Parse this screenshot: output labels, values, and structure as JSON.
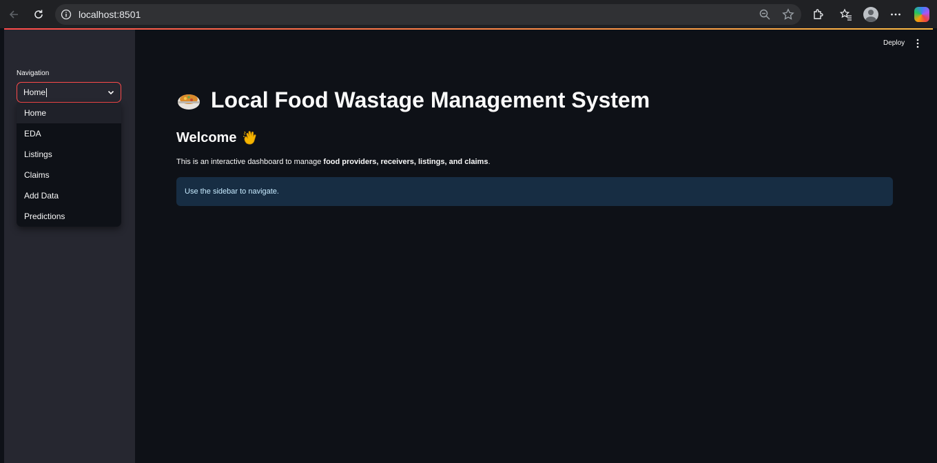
{
  "browser": {
    "url": "localhost:8501"
  },
  "app": {
    "deploy_label": "Deploy",
    "accent_color": "#ff4b4b"
  },
  "sidebar": {
    "nav_label": "Navigation",
    "select_value": "Home",
    "options": [
      {
        "label": "Home"
      },
      {
        "label": "EDA"
      },
      {
        "label": "Listings"
      },
      {
        "label": "Claims"
      },
      {
        "label": "Add Data"
      },
      {
        "label": "Predictions"
      }
    ]
  },
  "main": {
    "title": "Local Food Wastage Management System",
    "title_icon": "stew-pot-icon",
    "welcome": "Welcome",
    "welcome_icon": "waving-hand-icon",
    "intro_prefix": "This is an interactive dashboard to manage ",
    "intro_bold": "food providers, receivers, listings, and claims",
    "intro_suffix": ".",
    "info_text": "Use the sidebar to navigate."
  }
}
